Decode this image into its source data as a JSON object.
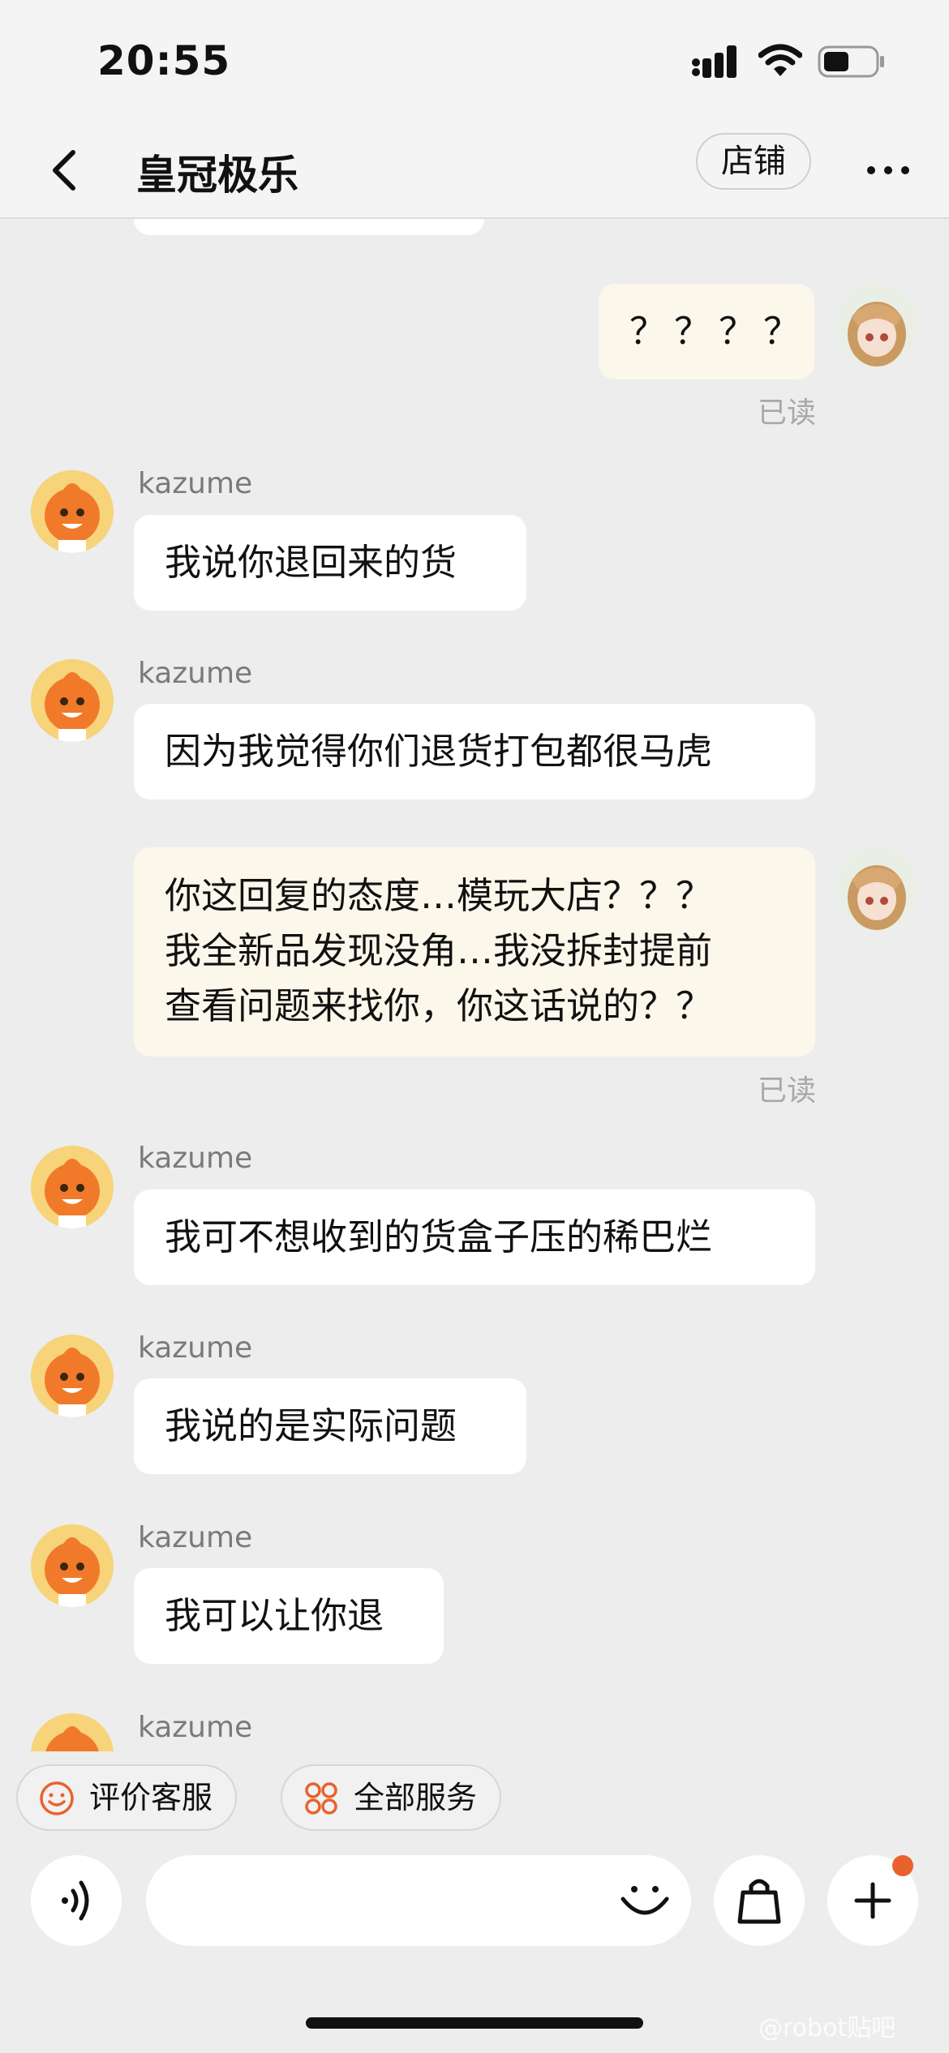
{
  "status_bar": {
    "time": "20:55"
  },
  "nav": {
    "title": "皇冠极乐",
    "store_label": "店铺"
  },
  "messages": [
    {
      "from": "me",
      "text": "？？？？",
      "read": "已读"
    },
    {
      "from": "kazume",
      "sender": "kazume",
      "text": "我说你退回来的货"
    },
    {
      "from": "kazume",
      "sender": "kazume",
      "text": "因为我觉得你们退货打包都很马虎"
    },
    {
      "from": "me",
      "text": "你这回复的态度…模玩大店？？？\n我全新品发现没角…我没拆封提前\n查看问题来找你，你这话说的？？",
      "read": "已读"
    },
    {
      "from": "kazume",
      "sender": "kazume",
      "text": "我可不想收到的货盒子压的稀巴烂"
    },
    {
      "from": "kazume",
      "sender": "kazume",
      "text": "我说的是实际问题"
    },
    {
      "from": "kazume",
      "sender": "kazume",
      "text": "我可以让你退"
    },
    {
      "from": "kazume",
      "sender": "kazume",
      "text": ""
    }
  ],
  "quick_actions": [
    {
      "label": "评价客服",
      "icon": "smile-icon"
    },
    {
      "label": "全部服务",
      "icon": "grid-services-icon"
    }
  ],
  "input": {
    "placeholder": ""
  },
  "watermark": "@robot贴吧",
  "colors": {
    "accent": "#e8622c",
    "my_bubble": "#fbf7ea",
    "background": "#ededed"
  }
}
